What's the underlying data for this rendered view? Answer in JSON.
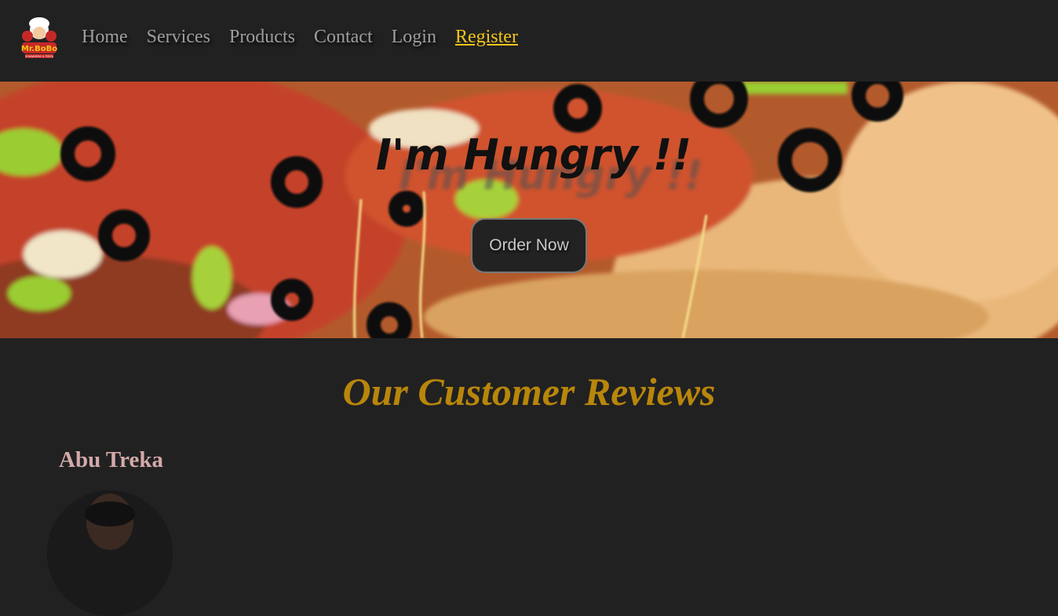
{
  "brand": {
    "logo_text": "Mr.BoBo",
    "logo_subtext": "SHAWARMA & PIZZA"
  },
  "nav": {
    "items": [
      {
        "label": "Home"
      },
      {
        "label": "Services"
      },
      {
        "label": "Products"
      },
      {
        "label": "Contact"
      },
      {
        "label": "Login"
      },
      {
        "label": "Register",
        "active": true
      }
    ]
  },
  "hero": {
    "title": "I'm Hungry !!",
    "button_label": "Order Now",
    "image": "pizza-slice-photo"
  },
  "reviews": {
    "title": "Our Customer Reviews",
    "items": [
      {
        "name": "Abu Treka"
      }
    ]
  },
  "colors": {
    "background": "#212121",
    "nav_text": "#9e9e9e",
    "nav_active": "#f5c518",
    "reviews_title": "#b8860b",
    "reviewer_name": "#d4a9a9"
  }
}
